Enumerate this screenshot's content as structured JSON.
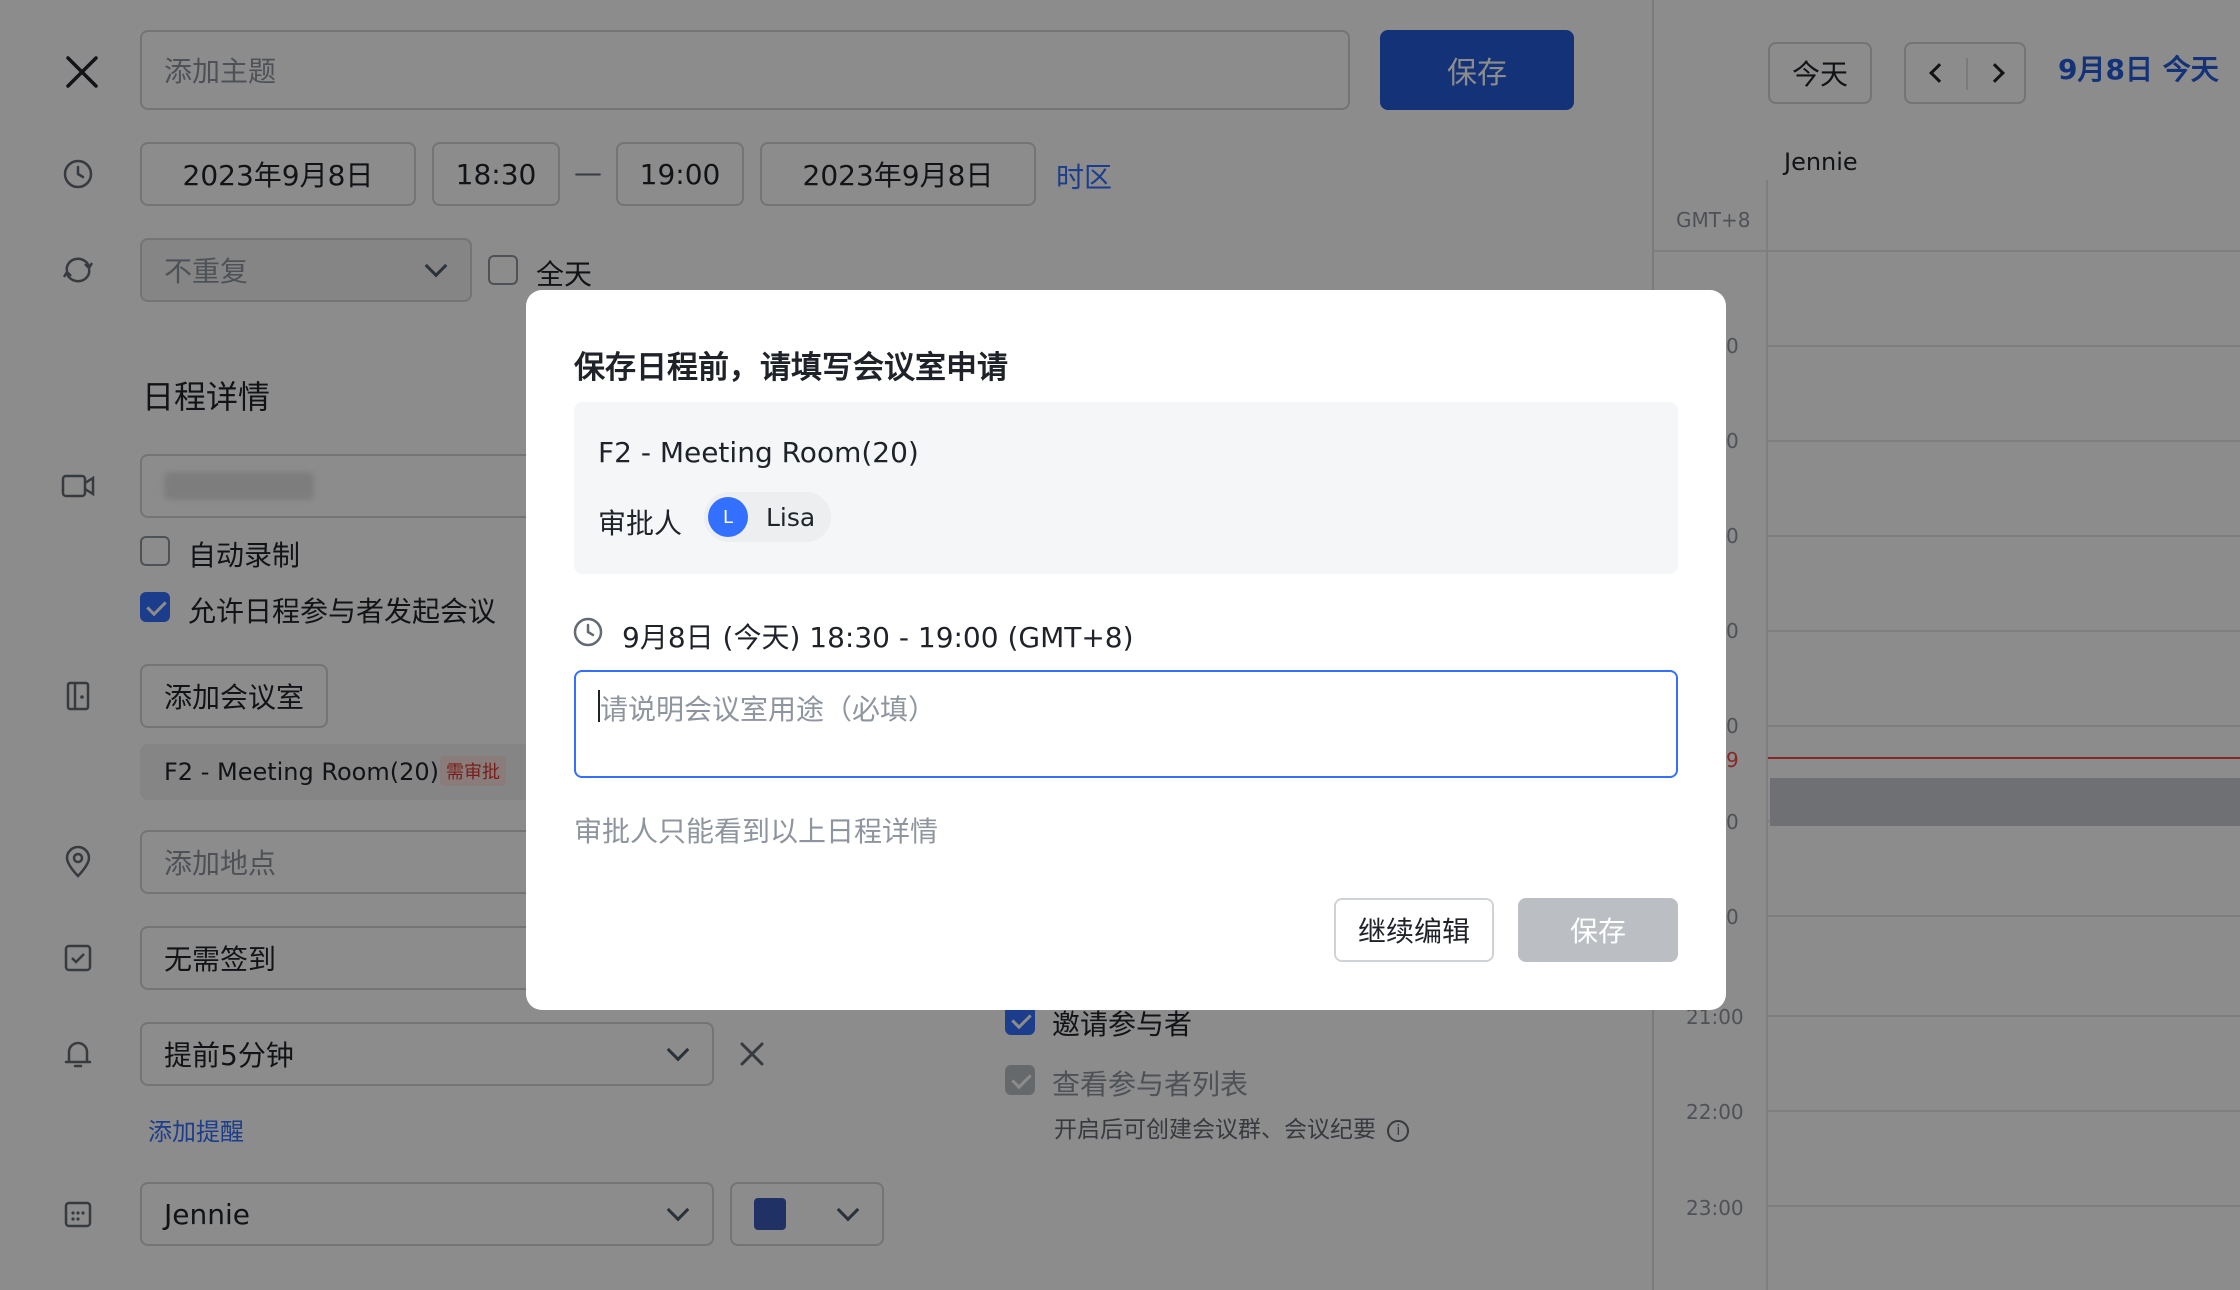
{
  "editor": {
    "subject_placeholder": "添加主题",
    "save_label": "保存",
    "start_date": "2023年9月8日",
    "start_time": "18:30",
    "dash": "—",
    "end_time": "19:00",
    "end_date": "2023年9月8日",
    "timezone_link": "时区",
    "repeat_value": "不重复",
    "allday_label": "全天",
    "details_heading": "日程详情",
    "auto_record_label": "自动录制",
    "allow_start_label": "允许日程参与者发起会议",
    "add_room_label": "添加会议室",
    "room_name": "F2 - Meeting Room(20)",
    "room_badge": "需审批",
    "location_placeholder": "添加地点",
    "checkin_value": "无需签到",
    "reminder_value": "提前5分钟",
    "add_reminder_link": "添加提醒",
    "calendar_value": "Jennie",
    "color_swatch": "#3b5bb8",
    "invite_label": "邀请参与者",
    "view_list_label": "查看参与者列表",
    "hint_text": "开启后可创建会议群、会议纪要"
  },
  "calendar": {
    "today_button": "今天",
    "date_title": "9月8日 今天",
    "column_name": "Jennie",
    "timezone": "GMT+8",
    "hours": [
      "21:00",
      "22:00",
      "23:00"
    ],
    "partial_labels": [
      "0",
      "0",
      "0",
      "0",
      "0",
      "0",
      "0",
      "9"
    ],
    "now_line_color": "#f54a45"
  },
  "dialog": {
    "title": "保存日程前，请填写会议室申请",
    "room_name": "F2 - Meeting Room(20)",
    "approver_label": "审批人",
    "approver_initial": "L",
    "approver_name": "Lisa",
    "time_text": "9月8日 (今天) 18:30 - 19:00 (GMT+8)",
    "purpose_placeholder": "请说明会议室用途（必填）",
    "note": "审批人只能看到以上日程详情",
    "continue_label": "继续编辑",
    "save_label": "保存"
  },
  "colors": {
    "primary": "#3370ff",
    "save_dark": "#245bdb",
    "overlay": "rgba(0,0,0,0.45)",
    "badge_red": "#f54a45"
  }
}
